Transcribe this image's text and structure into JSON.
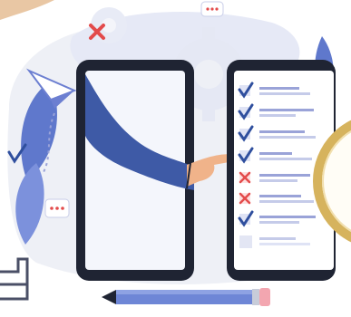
{
  "illustration": {
    "subject": "checklist-on-tablets",
    "icons": [
      "paper-plane-icon",
      "gear-icon",
      "chat-bubble-icon",
      "cross-icon",
      "check-icon",
      "pencil-icon",
      "magnifier-icon"
    ]
  },
  "colors": {
    "device_frame": "#1f2433",
    "screen": "#ffffff",
    "sleeve_blue": "#3e5aa6",
    "checkbox_blue": "#2f4f9e",
    "cross_red": "#e34b4b",
    "line_lavender": "#9aa3d8",
    "background_lavender": "#dfe3f5",
    "background_gray": "#eef0f6",
    "plane_blue": "#6c7fd1",
    "pencil_blue": "#6e86d6",
    "pencil_pink": "#f3a6b0",
    "gold_ring": "#d6b35d",
    "skin": "#f0b38a"
  },
  "checklist": {
    "rows": [
      {
        "mark": "check"
      },
      {
        "mark": "check"
      },
      {
        "mark": "check"
      },
      {
        "mark": "check"
      },
      {
        "mark": "cross"
      },
      {
        "mark": "cross"
      },
      {
        "mark": "check"
      },
      {
        "mark": "empty"
      }
    ]
  }
}
